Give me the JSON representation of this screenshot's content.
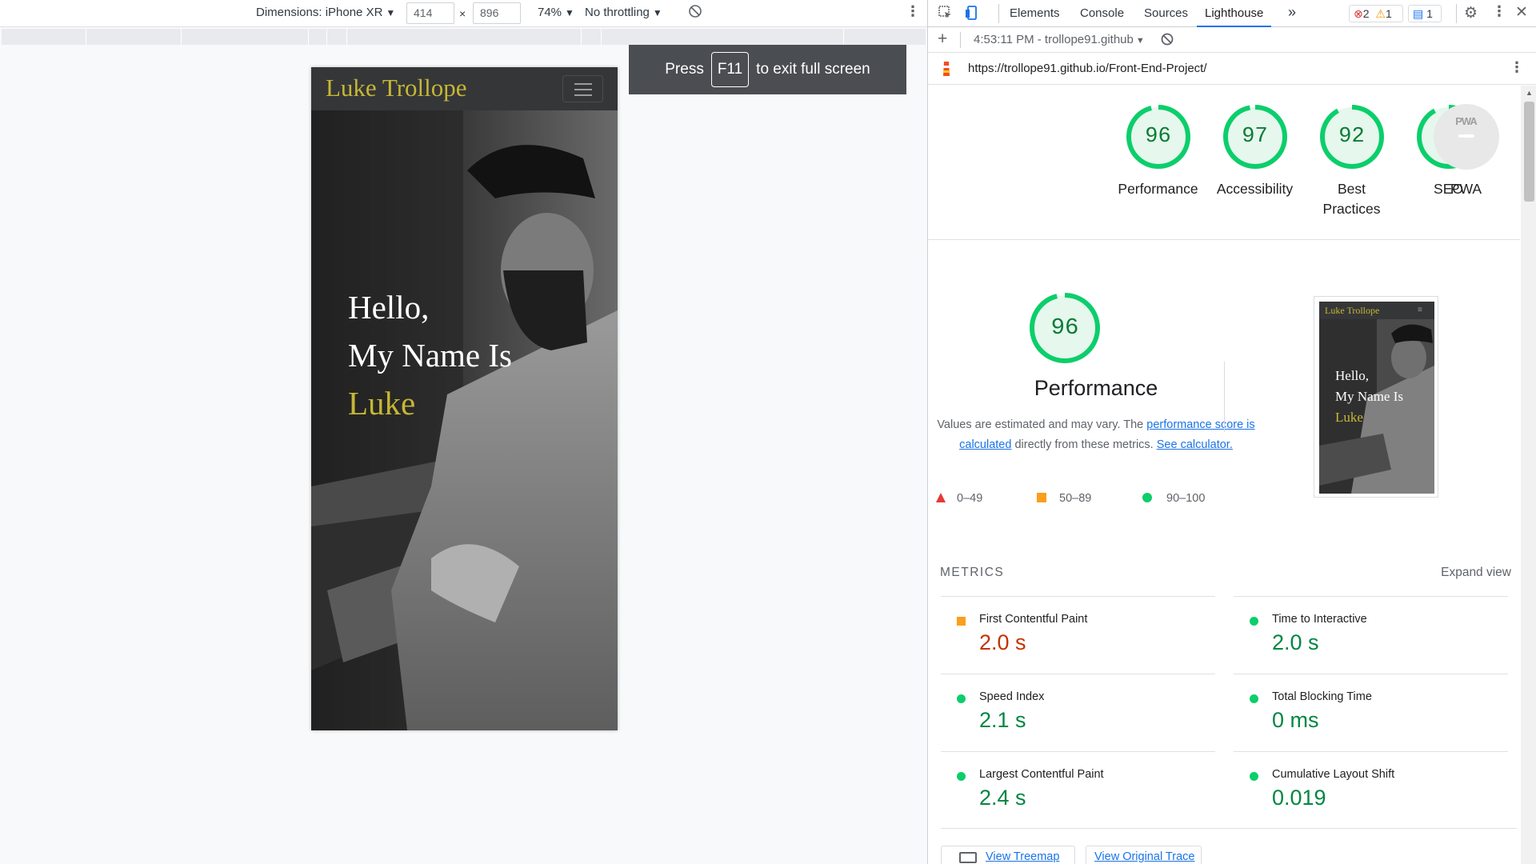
{
  "device_toolbar": {
    "dimensions_label": "Dimensions: iPhone XR",
    "width_value": "414",
    "times_symbol": "×",
    "height_value": "896",
    "zoom_label": "74%",
    "throttling_label": "No throttling"
  },
  "fullscreen_banner": {
    "press": "Press",
    "key": "F11",
    "rest": "to exit full screen"
  },
  "phone_site": {
    "brand": "Luke Trollope",
    "hero_line1": "Hello,",
    "hero_line2": "My Name Is",
    "hero_name": "Luke"
  },
  "devtools": {
    "tabs": [
      "Elements",
      "Console",
      "Sources",
      "Lighthouse"
    ],
    "more_tabs": "»",
    "errors_count": "2",
    "warnings_count": "1",
    "messages_count": "1",
    "report_selector": "4:53:11 PM - trollope91.github",
    "url": "https://trollope91.github.io/Front-End-Project/"
  },
  "scores": [
    {
      "label": "Performance",
      "value": 96
    },
    {
      "label": "Accessibility",
      "value": 97
    },
    {
      "label": "Best Practices",
      "value": 92
    },
    {
      "label": "SEO",
      "value": 92
    }
  ],
  "pwa": {
    "label": "PWA",
    "badge_text": "PWA"
  },
  "performance": {
    "score": 96,
    "title": "Performance",
    "desc_before": "Values are estimated and may vary. The",
    "desc_link": "performance score is calculated",
    "desc_after": "directly from these metrics.",
    "calc_link": "See calculator."
  },
  "legend": {
    "fail": "0–49",
    "average": "50–89",
    "pass": "90–100"
  },
  "metrics_header": {
    "title": "METRICS",
    "expand": "Expand view"
  },
  "metrics": [
    {
      "label": "First Contentful Paint",
      "value": "2.0 s",
      "status": "average"
    },
    {
      "label": "Time to Interactive",
      "value": "2.0 s",
      "status": "pass"
    },
    {
      "label": "Speed Index",
      "value": "2.1 s",
      "status": "pass"
    },
    {
      "label": "Total Blocking Time",
      "value": "0 ms",
      "status": "pass"
    },
    {
      "label": "Largest Contentful Paint",
      "value": "2.4 s",
      "status": "pass"
    },
    {
      "label": "Cumulative Layout Shift",
      "value": "0.019",
      "status": "pass"
    }
  ],
  "buttons": {
    "treemap": "View Treemap",
    "trace": "View Original Trace"
  },
  "colors": {
    "pass": "#0cce6b",
    "average": "#fa9f1b",
    "fail": "#e53935",
    "brand_gold": "#c6b734",
    "link_blue": "#1a73e8"
  }
}
